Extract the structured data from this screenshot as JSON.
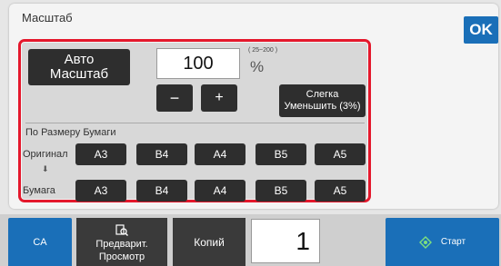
{
  "dialog": {
    "title": "Масштаб",
    "ok_label": "OK"
  },
  "zoom": {
    "auto_label": "Авто\nМасштаб",
    "value": "100",
    "range": "( 25~200 )",
    "unit": "%",
    "minus_label": "−",
    "plus_label": "+",
    "slight_reduce_label": "Слегка\nУменьшить (3%)"
  },
  "paper_fit": {
    "section_label": "По Размеру Бумаги",
    "original_label": "Оригинал",
    "arrow": "⬇",
    "paper_label": "Бумага",
    "original_sizes": [
      "A3",
      "B4",
      "A4",
      "B5",
      "A5"
    ],
    "paper_sizes": [
      "A3",
      "B4",
      "A4",
      "B5",
      "A5"
    ]
  },
  "bottom_bar": {
    "ca_label": "CA",
    "preview_label": "Предварит.\nПросмотр",
    "copies_label": "Копий",
    "copies_value": "1",
    "start_label": "Старт"
  },
  "colors": {
    "accent": "#1a6fb8",
    "highlight": "#e4182c",
    "button_dark": "#2e2e2e"
  }
}
